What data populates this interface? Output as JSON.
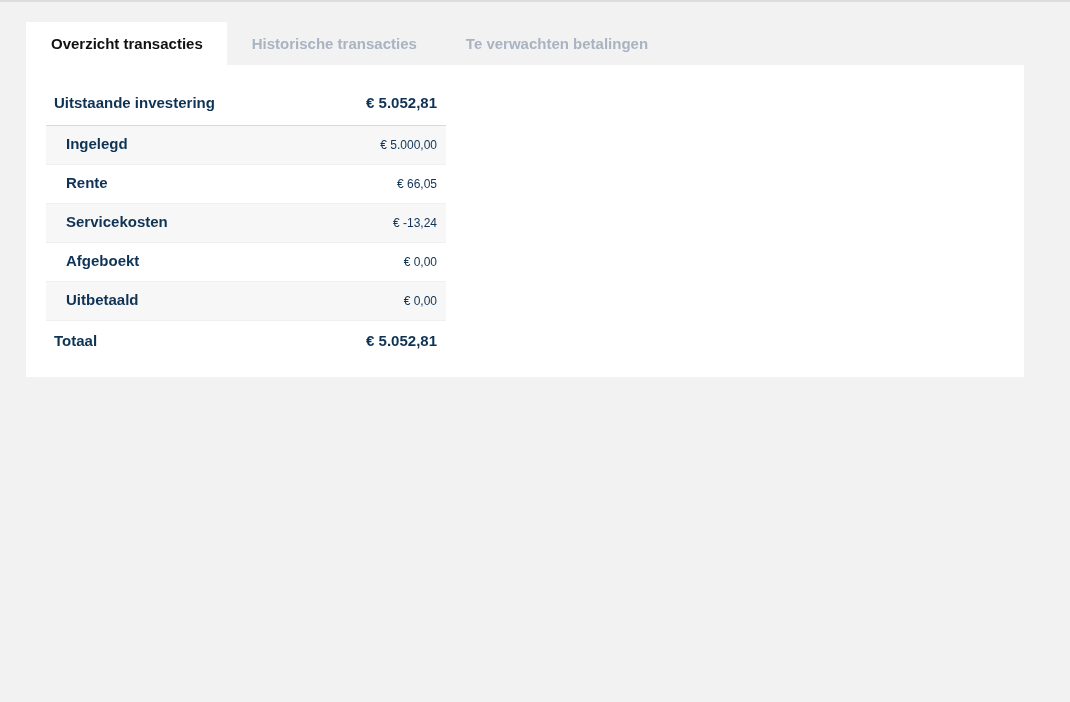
{
  "tabs": [
    {
      "label": "Overzicht transacties",
      "selected": true
    },
    {
      "label": "Historische transacties",
      "selected": false
    },
    {
      "label": "Te verwachten betalingen",
      "selected": false
    }
  ],
  "overview": {
    "header": {
      "label": "Uitstaande investering",
      "amount": "€ 5.052,81"
    },
    "rows": [
      {
        "label": "Ingelegd",
        "amount": "€ 5.000,00"
      },
      {
        "label": "Rente",
        "amount": "€ 66,05"
      },
      {
        "label": "Servicekosten",
        "amount": "€ -13,24"
      },
      {
        "label": "Afgeboekt",
        "amount": "€ 0,00"
      },
      {
        "label": "Uitbetaald",
        "amount": "€ 0,00"
      }
    ],
    "total": {
      "label": "Totaal",
      "amount": "€ 5.052,81"
    }
  }
}
